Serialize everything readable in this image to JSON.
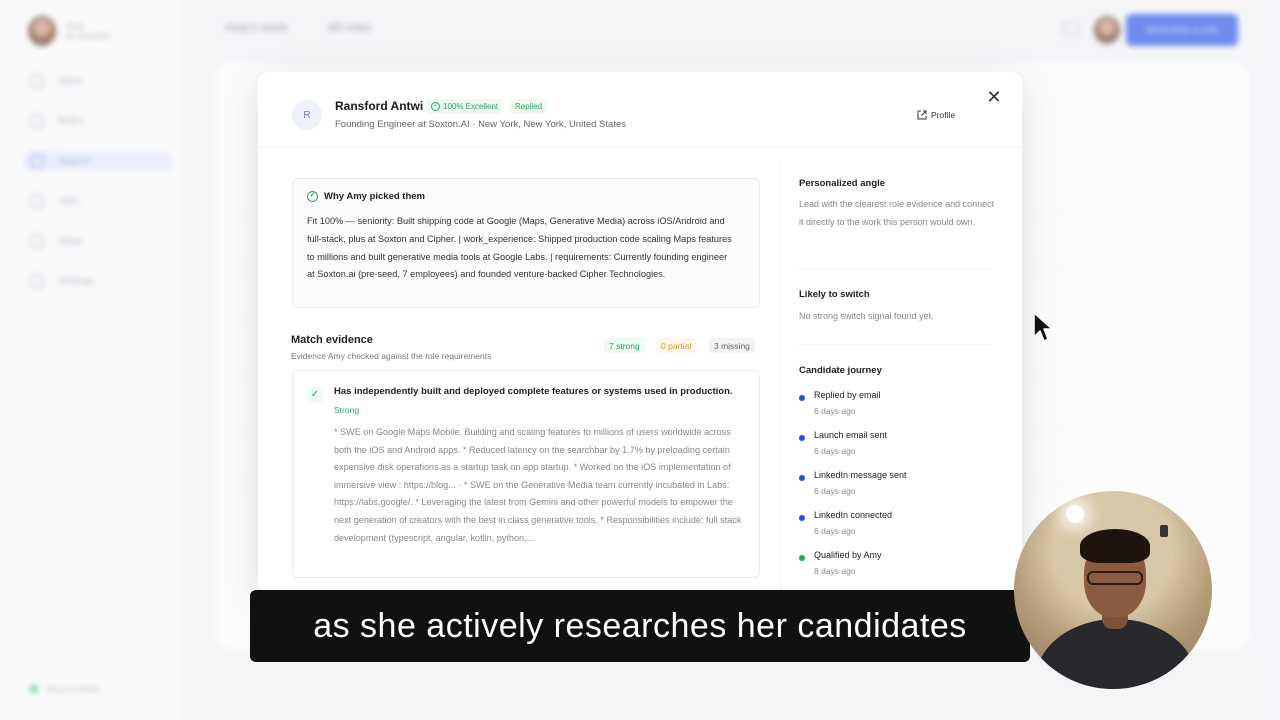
{
  "background": {
    "sidebar": {
      "user_name": "Amy",
      "user_sub": "AI recruiter",
      "items": [
        "Inbox",
        "Roles",
        "Search",
        "Jobs",
        "Ideas",
        "Settings"
      ],
      "status": "Amy is online"
    },
    "topbar": {
      "tabs": [
        "Amy's week",
        "All roles"
      ],
      "primary_button": "Send Amy a role"
    }
  },
  "modal": {
    "avatar_initial": "R",
    "name": "Ransford Antwi",
    "badge_score": "100% Excellent",
    "badge_status": "Replied",
    "subtitle": "Founding Engineer at Soxton.AI · New York, New York, United States",
    "profile_link": "Profile",
    "close_icon": "close-icon",
    "why": {
      "title": "Why Amy picked them",
      "text": "Fit 100% — seniority: Built shipping code at Google (Maps, Generative Media) across iOS/Android and full-stack, plus at Soxton and Cipher. | work_experience: Shipped production code scaling Maps features to millions and built generative media tools at Google Labs. | requirements: Currently founding engineer at Soxton.ai (pre-seed, 7 employees) and founded venture-backed Cipher Technologies."
    },
    "match": {
      "title": "Match evidence",
      "subtitle": "Evidence Amy checked against the role requirements",
      "strong_tag": "7 strong",
      "partial_tag": "0 partial",
      "missing_tag": "3 missing"
    },
    "evidence": {
      "title": "Has independently built and deployed complete features or systems used in production.",
      "strength": "Strong",
      "text": "* SWE on Google Maps Mobile. Building and scaling features to millions of users worldwide across both the iOS and Android apps. * Reduced latency on the searchbar by 1.7% by preloading certain expensive disk operations as a startup task on app startup. * Worked on the iOS implementation of immersive view : https://blog... · * SWE on the Generative Media team currently incubated in Labs: https://labs.google/. * Leveraging the latest from Gemini and other powerful models to empower the next generation of creators with the best in class generative tools. * Responsibilities include: full stack development (typescript, angular, kotlin, python,..."
    },
    "right": {
      "angle_title": "Personalized angle",
      "angle_text": "Lead with the clearest role evidence and connect it directly to the work this person would own.",
      "switch_title": "Likely to switch",
      "switch_text": "No strong switch signal found yet.",
      "journey_title": "Candidate journey",
      "journey": [
        {
          "label": "Replied by email",
          "time": "6 days ago",
          "color": "#2b50c9"
        },
        {
          "label": "Launch email sent",
          "time": "6 days ago",
          "color": "#2b50c9"
        },
        {
          "label": "LinkedIn message sent",
          "time": "6 days ago",
          "color": "#2b50c9"
        },
        {
          "label": "LinkedIn connected",
          "time": "6 days ago",
          "color": "#2b50c9"
        },
        {
          "label": "Qualified by Amy",
          "time": "8 days ago",
          "color": "#2fa65a"
        }
      ]
    }
  },
  "caption": "as she actively researches her candidates",
  "colors": {
    "accent": "#2553e8",
    "success": "#2fa65a",
    "warning": "#d99a2b"
  }
}
